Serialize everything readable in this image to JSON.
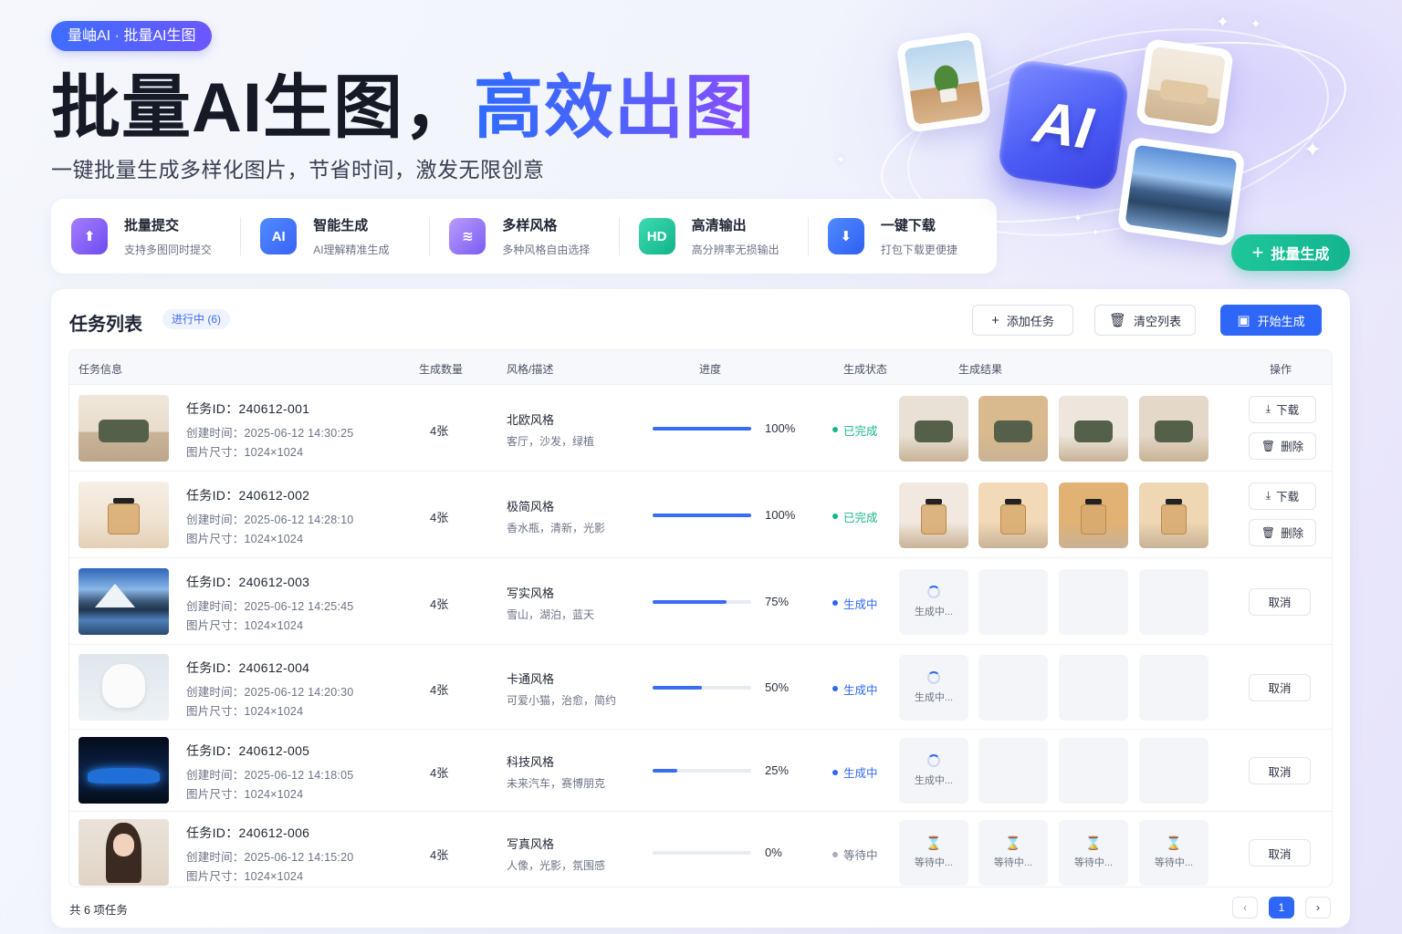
{
  "hero": {
    "tag": "量岫AI · 批量AI生图",
    "title_part1": "批量AI生图，",
    "title_part2": "高效出图",
    "subtitle": "一键批量生成多样化图片，节省时间，激发无限创意",
    "cta_label": "批量生成",
    "ai_badge": "AI",
    "features": [
      {
        "icon": "upload-icon",
        "glyph": "⬆",
        "title": "批量提交",
        "desc": "支持多图同时提交"
      },
      {
        "icon": "ai-chip-icon",
        "glyph": "AI",
        "title": "智能生成",
        "desc": "AI理解精准生成"
      },
      {
        "icon": "layers-icon",
        "glyph": "≋",
        "title": "多样风格",
        "desc": "多种风格自由选择"
      },
      {
        "icon": "hd-icon",
        "glyph": "HD",
        "title": "高清输出",
        "desc": "高分辨率无损输出"
      },
      {
        "icon": "download-icon",
        "glyph": "⬇",
        "title": "一键下载",
        "desc": "打包下载更便捷"
      }
    ]
  },
  "panel": {
    "title": "任务列表",
    "running_badge": "进行中 (6)",
    "buttons": {
      "add": "添加任务",
      "clear": "清空列表",
      "start": "开始生成"
    },
    "columns": [
      "任务信息",
      "生成数量",
      "风格/描述",
      "进度",
      "生成状态",
      "生成结果",
      "操作"
    ],
    "labels": {
      "id_prefix": "任务ID：",
      "created_prefix": "创建时间：",
      "size_prefix": "图片尺寸："
    },
    "rows": [
      {
        "id": "240612-001",
        "created": "2025-06-12 14:30:25",
        "size": "1024×1024",
        "qty": "4张",
        "style": "北欧风格",
        "desc": "客厅，沙发，绿植",
        "progress": 100,
        "progress_text": "100%",
        "status": "已完成",
        "status_type": "done",
        "theme": "sofa",
        "results": [
          "image",
          "image",
          "image",
          "image"
        ]
      },
      {
        "id": "240612-002",
        "created": "2025-06-12 14:28:10",
        "size": "1024×1024",
        "qty": "4张",
        "style": "极简风格",
        "desc": "香水瓶，清新，光影",
        "progress": 100,
        "progress_text": "100%",
        "status": "已完成",
        "status_type": "done",
        "theme": "perfume",
        "results": [
          "image",
          "image",
          "image",
          "image"
        ]
      },
      {
        "id": "240612-003",
        "created": "2025-06-12 14:25:45",
        "size": "1024×1024",
        "qty": "4张",
        "style": "写实风格",
        "desc": "雪山，湖泊，蓝天",
        "progress": 75,
        "progress_text": "75%",
        "status": "生成中",
        "status_type": "run",
        "theme": "mountain",
        "results": [
          "generating",
          "empty",
          "empty",
          "empty"
        ]
      },
      {
        "id": "240612-004",
        "created": "2025-06-12 14:20:30",
        "size": "1024×1024",
        "qty": "4张",
        "style": "卡通风格",
        "desc": "可爱小猫，治愈，简约",
        "progress": 50,
        "progress_text": "50%",
        "status": "生成中",
        "status_type": "run",
        "theme": "cat",
        "results": [
          "generating",
          "empty",
          "empty",
          "empty"
        ]
      },
      {
        "id": "240612-005",
        "created": "2025-06-12 14:18:05",
        "size": "1024×1024",
        "qty": "4张",
        "style": "科技风格",
        "desc": "未来汽车，赛博朋克",
        "progress": 25,
        "progress_text": "25%",
        "status": "生成中",
        "status_type": "run",
        "theme": "car",
        "results": [
          "generating",
          "empty",
          "empty",
          "empty"
        ]
      },
      {
        "id": "240612-006",
        "created": "2025-06-12 14:15:20",
        "size": "1024×1024",
        "qty": "4张",
        "style": "写真风格",
        "desc": "人像，光影，氛围感",
        "progress": 0,
        "progress_text": "0%",
        "status": "等待中",
        "status_type": "wait",
        "theme": "portrait",
        "results": [
          "waiting",
          "waiting",
          "waiting",
          "waiting"
        ]
      }
    ],
    "actions": {
      "download": "下载",
      "delete": "删除",
      "cancel": "取消"
    },
    "result_texts": {
      "generating": "生成中...",
      "waiting": "等待中..."
    },
    "footer": "共 6 项任务",
    "pagination": {
      "prev": "‹",
      "current": "1",
      "next": "›"
    }
  },
  "colors": {
    "primary": "#2e67f7",
    "success": "#17b58b",
    "cta": "#13b58f",
    "accent_purple": "#6b57ff"
  }
}
